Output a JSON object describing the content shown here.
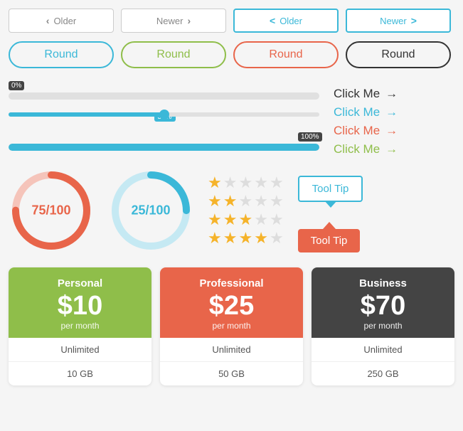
{
  "pagination": {
    "row1": [
      {
        "label": "Older",
        "chevron_left": "‹",
        "style": "outline-gray",
        "direction": "left"
      },
      {
        "label": "Newer",
        "chevron_right": "›",
        "style": "outline-gray",
        "direction": "right"
      },
      {
        "label": "Older",
        "chevron_left": "<",
        "style": "outline-gray active-left",
        "direction": "left"
      },
      {
        "label": "Newer",
        "chevron_right": ">",
        "style": "outline-blue-active",
        "direction": "right"
      }
    ]
  },
  "round_buttons": [
    {
      "label": "Round",
      "style": "cyan"
    },
    {
      "label": "Round",
      "style": "olive"
    },
    {
      "label": "Round",
      "style": "salmon"
    },
    {
      "label": "Round",
      "style": "dark"
    }
  ],
  "progress_bars": [
    {
      "label": "0%",
      "value": 0,
      "color": "blue"
    },
    {
      "label": "50%",
      "value": 50,
      "color": "blue"
    },
    {
      "label": "100%",
      "value": 100,
      "color": "blue"
    }
  ],
  "click_me_links": [
    {
      "label": "Click Me",
      "arrow": "→",
      "style": "dark-arrow"
    },
    {
      "label": "Click Me",
      "arrow": "→",
      "style": "cyan-arrow"
    },
    {
      "label": "Click Me",
      "arrow": "→",
      "style": "salmon-arrow"
    },
    {
      "label": "Click Me",
      "arrow": "→",
      "style": "olive-arrow"
    }
  ],
  "circles": [
    {
      "value": 75,
      "max": 100,
      "label": "75/100",
      "color": "#e8654a",
      "track": "#f5c4ba",
      "style": "red"
    },
    {
      "value": 25,
      "max": 100,
      "label": "25/100",
      "color": "#3bb8d8",
      "track": "#c5e9f3",
      "style": "blue"
    }
  ],
  "stars": [
    {
      "filled": 1,
      "empty": 4
    },
    {
      "filled": 2,
      "empty": 3
    },
    {
      "filled": 3,
      "empty": 2
    },
    {
      "filled": 4,
      "empty": 1
    }
  ],
  "tooltips": [
    {
      "label": "Tool Tip",
      "style": "outline-cyan",
      "arrow": "down"
    },
    {
      "label": "Tool Tip",
      "style": "filled-salmon",
      "arrow": "up"
    }
  ],
  "pricing": [
    {
      "plan": "Personal",
      "price": "$10",
      "period": "per month",
      "header_style": "green",
      "features": [
        "Unlimited",
        "10 GB"
      ]
    },
    {
      "plan": "Professional",
      "price": "$25",
      "period": "per month",
      "header_style": "salmon",
      "features": [
        "Unlimited",
        "50 GB"
      ]
    },
    {
      "plan": "Business",
      "price": "$70",
      "period": "per month",
      "header_style": "dark",
      "features": [
        "Unlimited",
        "250 GB"
      ]
    }
  ]
}
